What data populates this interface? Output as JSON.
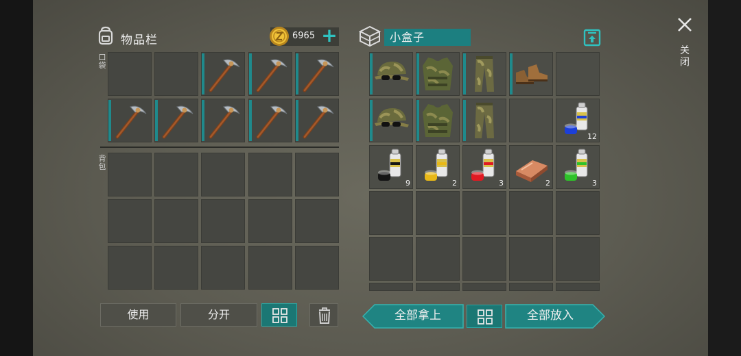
{
  "inventory": {
    "title": "物品栏",
    "currency_amount": "6965",
    "add_currency_icon": "plus-icon",
    "pocket_label": "口袋",
    "backpack_label": "背包",
    "pocket_slots": [
      {
        "item": ""
      },
      {
        "item": ""
      },
      {
        "item": "pickaxe"
      },
      {
        "item": "pickaxe"
      },
      {
        "item": "pickaxe"
      },
      {
        "item": "pickaxe"
      },
      {
        "item": "pickaxe"
      },
      {
        "item": "pickaxe"
      },
      {
        "item": "pickaxe"
      },
      {
        "item": "pickaxe"
      }
    ],
    "buttons": {
      "use": "使用",
      "split": "分开"
    }
  },
  "container": {
    "name": "小盒子",
    "slots": [
      {
        "item": "camo-cap",
        "count": ""
      },
      {
        "item": "camo-vest",
        "count": ""
      },
      {
        "item": "camo-pants",
        "count": ""
      },
      {
        "item": "boots",
        "count": ""
      },
      {
        "item": "",
        "count": ""
      },
      {
        "item": "camo-cap",
        "count": ""
      },
      {
        "item": "camo-vest",
        "count": ""
      },
      {
        "item": "camo-pants",
        "count": ""
      },
      {
        "item": "",
        "count": ""
      },
      {
        "item": "spray-paint-blue",
        "count": "12"
      },
      {
        "item": "spray-paint-black",
        "count": "9"
      },
      {
        "item": "spray-paint-yellow",
        "count": "2"
      },
      {
        "item": "spray-paint-red",
        "count": "3"
      },
      {
        "item": "copper-ingot",
        "count": "2"
      },
      {
        "item": "spray-paint-green",
        "count": "3"
      }
    ],
    "buttons": {
      "take_all": "全部拿上",
      "put_all": "全部放入"
    }
  },
  "close_label": "关闭",
  "colors": {
    "accent": "#1f8482",
    "slot": "#454641",
    "panel": "#5c5b51"
  }
}
